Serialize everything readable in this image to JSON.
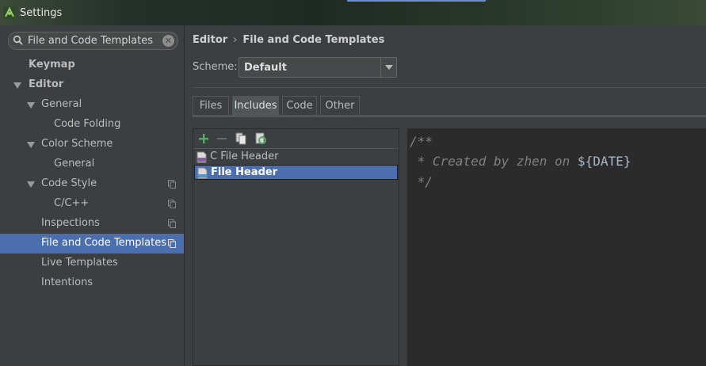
{
  "window": {
    "title": "Settings"
  },
  "search": {
    "value": "File and Code Templates",
    "clear_glyph": "✕"
  },
  "sidebar": {
    "items": [
      {
        "label": "Keymap"
      },
      {
        "label": "Editor"
      },
      {
        "label": "General"
      },
      {
        "label": "Code Folding"
      },
      {
        "label": "Color Scheme"
      },
      {
        "label": "General"
      },
      {
        "label": "Code Style"
      },
      {
        "label": "C/C++"
      },
      {
        "label": "Inspections"
      },
      {
        "label": "File and Code Templates"
      },
      {
        "label": "Live Templates"
      },
      {
        "label": "Intentions"
      }
    ]
  },
  "breadcrumb": {
    "parent": "Editor",
    "separator": "›",
    "current": "File and Code Templates"
  },
  "scheme": {
    "label": "Scheme:",
    "value": "Default"
  },
  "tabs": [
    {
      "label": "Files"
    },
    {
      "label": "Includes"
    },
    {
      "label": "Code"
    },
    {
      "label": "Other"
    }
  ],
  "templates": {
    "items": [
      {
        "name": "C File Header"
      },
      {
        "name": "File Header"
      }
    ]
  },
  "editor": {
    "lines": [
      "/**",
      " * Created by zhen on ",
      "${DATE}",
      " */"
    ]
  },
  "colors": {
    "selection": "#4b6eaf",
    "add": "#59a869",
    "background": "#3c3f41",
    "editor_bg": "#2b2b2b"
  }
}
